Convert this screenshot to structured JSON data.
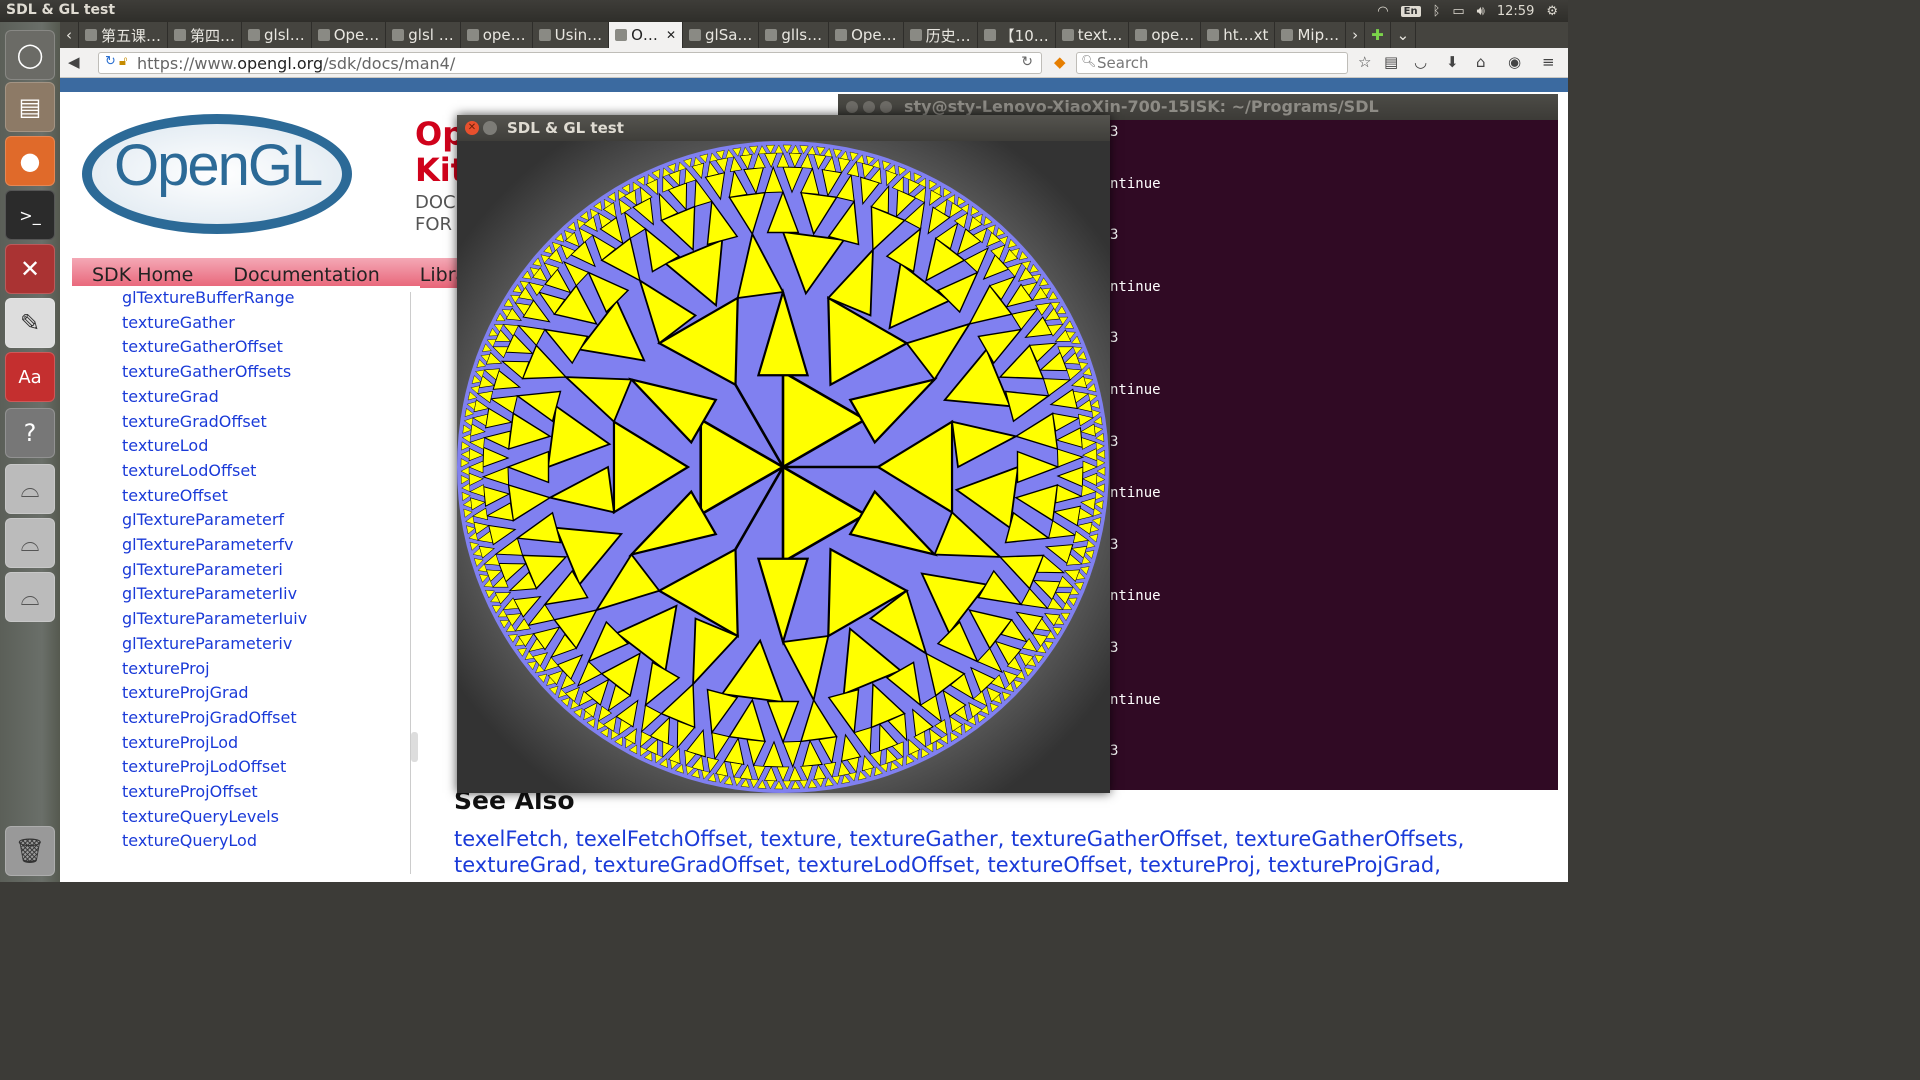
{
  "system": {
    "app_title": "SDL & GL test",
    "language": "En",
    "clock": "12:59"
  },
  "launcher": {
    "items": [
      "dash-icon",
      "files-icon",
      "firefox-icon",
      "terminal-icon",
      "settings-icon",
      "text-editor-icon",
      "dictionary-icon",
      "help-icon",
      "drive-icon",
      "drive-icon",
      "drive-icon",
      "trash-icon"
    ]
  },
  "browser": {
    "tabs": [
      {
        "label": "第五课…"
      },
      {
        "label": "第四…"
      },
      {
        "label": "glsl…"
      },
      {
        "label": "Ope…"
      },
      {
        "label": "glsl …"
      },
      {
        "label": "ope…"
      },
      {
        "label": "Usin…"
      },
      {
        "label": "O…",
        "active": true
      },
      {
        "label": "glSa…"
      },
      {
        "label": "glls…"
      },
      {
        "label": "Ope…"
      },
      {
        "label": "历史…"
      },
      {
        "label": "【10…"
      },
      {
        "label": "text…"
      },
      {
        "label": "ope…"
      },
      {
        "label": "ht…xt"
      },
      {
        "label": "Mip…"
      }
    ],
    "url_prefix": "https://www.",
    "url_host": "opengl.org",
    "url_path": "/sdk/docs/man4/",
    "search_placeholder": "Search"
  },
  "page": {
    "logo": "OpenGL",
    "kit_title_1": "Op",
    "kit_title_2": "Kit",
    "kit_sub_1": "DOC",
    "kit_sub_2": "FOR",
    "nav": [
      "SDK Home",
      "Documentation",
      "Librarie"
    ],
    "sidebar_items": [
      "glTextureBufferRange",
      "textureGather",
      "textureGatherOffset",
      "textureGatherOffsets",
      "textureGrad",
      "textureGradOffset",
      "textureLod",
      "textureLodOffset",
      "textureOffset",
      "glTextureParameterf",
      "glTextureParameterfv",
      "glTextureParameteri",
      "glTextureParameterIiv",
      "glTextureParameterIuiv",
      "glTextureParameteriv",
      "textureProj",
      "textureProjGrad",
      "textureProjGradOffset",
      "textureProjLod",
      "textureProjLodOffset",
      "textureProjOffset",
      "textureQueryLevels",
      "textureQueryLod"
    ],
    "see_also_heading": "See Also",
    "see_also_line1": "texelFetch, texelFetchOffset, texture, textureGather, textureGatherOffset, textureGatherOffsets,",
    "see_also_line2": "textureGrad, textureGradOffset, textureLodOffset, textureOffset, textureProj, textureProjGrad,"
  },
  "terminal": {
    "title": "sty@sty-Lenovo-XiaoXin-700-15ISK: ~/Programs/SDL",
    "lines": [
      "3",
      "ntinue",
      "3",
      "ntinue",
      "3",
      "ntinue",
      "3",
      "ntinue",
      "3",
      "ntinue",
      "3",
      "ntinue",
      "3"
    ]
  },
  "sdl_window": {
    "title": "SDL & GL test",
    "colors": {
      "yellow": "#ffff00",
      "blue": "#8080f0",
      "edge": "#000000"
    }
  }
}
